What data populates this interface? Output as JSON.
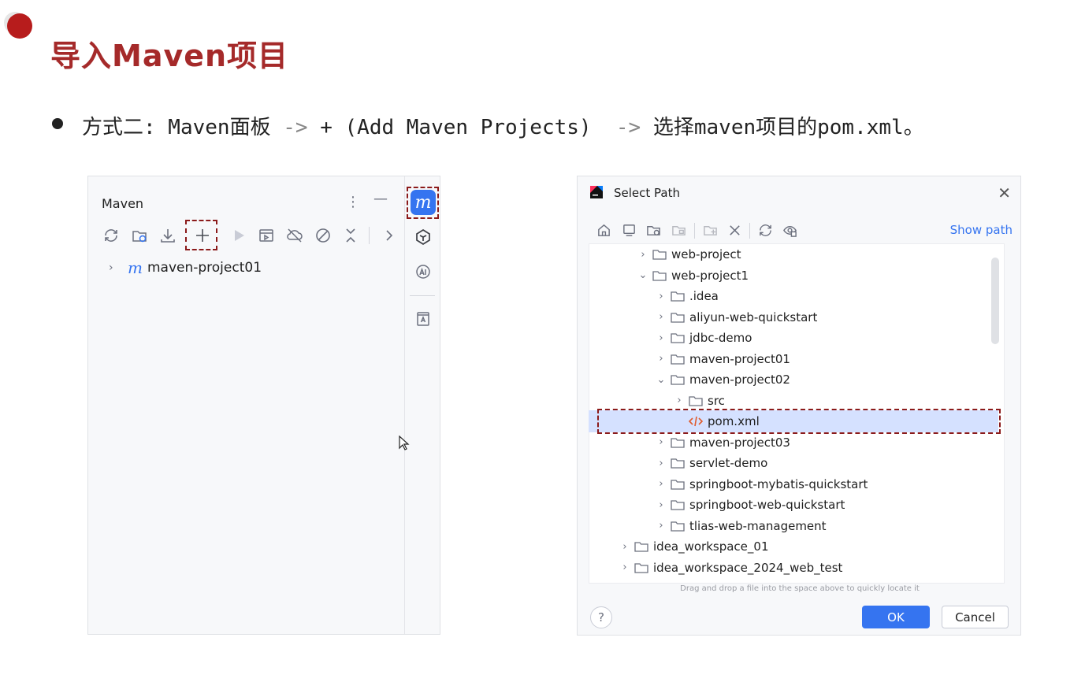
{
  "slide": {
    "title": "导入Maven项目",
    "bullet": {
      "prefix": "方式二: Maven面板 ",
      "arrow1": "->",
      "middle": " + (Add Maven Projects)  ",
      "arrow2": "->",
      "suffix": " 选择maven项目的pom.xml。"
    }
  },
  "maven_panel": {
    "title": "Maven",
    "more_icon": "more-vertical-icon",
    "minimize_icon": "minimize-icon",
    "toolbar": [
      "reload-icon",
      "generate-sources-icon",
      "download-icon",
      "add-icon",
      "run-icon",
      "execute-goal-icon",
      "offline-icon",
      "skip-tests-icon",
      "collapse-all-icon",
      "more-icon"
    ],
    "project": {
      "badge": "m",
      "name": "maven-project01"
    },
    "side_badge": "m",
    "highlight_color": "#8b1a1a"
  },
  "dialog": {
    "title": "Select Path",
    "show_path": "Show path",
    "tree": [
      {
        "label": "web-project",
        "depth": 0,
        "expanded": false,
        "type": "folder"
      },
      {
        "label": "web-project1",
        "depth": 0,
        "expanded": true,
        "type": "folder"
      },
      {
        "label": ".idea",
        "depth": 1,
        "expanded": false,
        "type": "folder"
      },
      {
        "label": "aliyun-web-quickstart",
        "depth": 1,
        "expanded": false,
        "type": "folder"
      },
      {
        "label": "jdbc-demo",
        "depth": 1,
        "expanded": false,
        "type": "folder"
      },
      {
        "label": "maven-project01",
        "depth": 1,
        "expanded": false,
        "type": "folder"
      },
      {
        "label": "maven-project02",
        "depth": 1,
        "expanded": true,
        "type": "folder"
      },
      {
        "label": "src",
        "depth": 2,
        "expanded": false,
        "type": "folder"
      },
      {
        "label": "pom.xml",
        "depth": 2,
        "expanded": null,
        "type": "xml",
        "selected": true
      },
      {
        "label": "maven-project03",
        "depth": 1,
        "expanded": false,
        "type": "folder"
      },
      {
        "label": "servlet-demo",
        "depth": 1,
        "expanded": false,
        "type": "folder"
      },
      {
        "label": "springboot-mybatis-quickstart",
        "depth": 1,
        "expanded": false,
        "type": "folder"
      },
      {
        "label": "springboot-web-quickstart",
        "depth": 1,
        "expanded": false,
        "type": "folder"
      },
      {
        "label": "tlias-web-management",
        "depth": 1,
        "expanded": false,
        "type": "folder"
      },
      {
        "label": "idea_workspace_01",
        "depth": -1,
        "expanded": false,
        "type": "folder"
      },
      {
        "label": "idea_workspace_2024_web_test",
        "depth": -1,
        "expanded": false,
        "type": "folder"
      }
    ],
    "drag_hint": "Drag and drop a file into the space above to quickly locate it",
    "help": "?",
    "ok": "OK",
    "cancel": "Cancel",
    "accent": "#3574f0"
  }
}
